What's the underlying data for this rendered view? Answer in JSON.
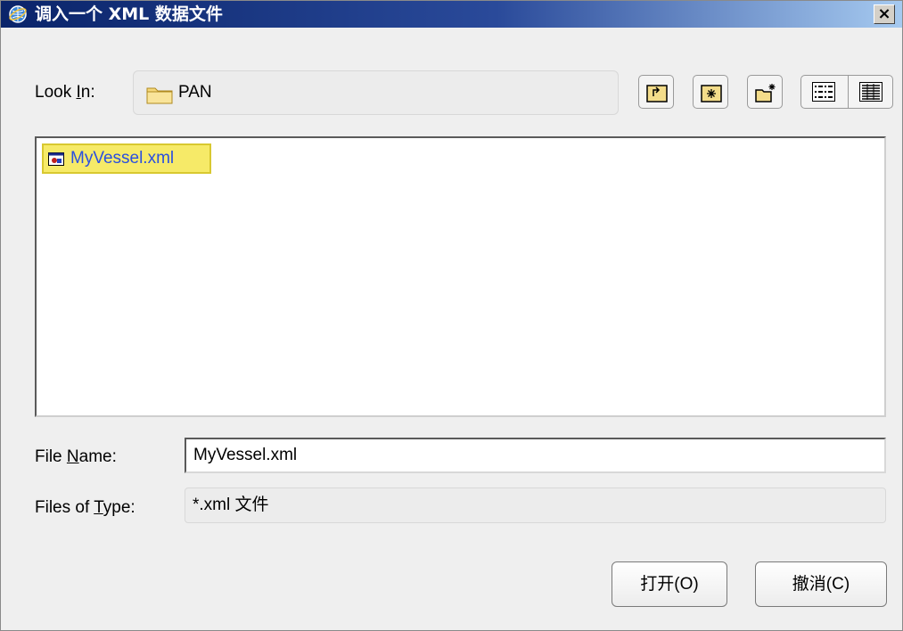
{
  "window": {
    "title": "调入一个 XML 数据文件",
    "close_glyph": "×",
    "title_icon": "ie-globe-icon"
  },
  "look_in": {
    "label_before": "Look ",
    "label_mnemonic": "I",
    "label_after": "n:",
    "value": "PAN",
    "folder_icon": "folder-icon"
  },
  "toolbar": {
    "buttons": [
      {
        "name": "up-one-level-icon"
      },
      {
        "name": "home-folder-icon"
      },
      {
        "name": "new-folder-icon"
      },
      {
        "name": "list-view-icon"
      },
      {
        "name": "details-view-icon"
      }
    ]
  },
  "files": [
    {
      "name": "MyVessel.xml",
      "selected": true,
      "icon": "xml-file-icon"
    }
  ],
  "file_name": {
    "label_before": "File ",
    "label_mnemonic": "N",
    "label_after": "ame:",
    "value": "MyVessel.xml"
  },
  "file_type": {
    "label_before": "Files of ",
    "label_mnemonic": "T",
    "label_after": "ype:",
    "value": "*.xml 文件"
  },
  "buttons": {
    "open": "打开(O)",
    "cancel": "撤消(C)"
  },
  "colors": {
    "title_gradient_start": "#0a246a",
    "title_gradient_end": "#a6caf0",
    "selection_fill": "#f6ea68",
    "selection_text": "#2a4fe0"
  }
}
